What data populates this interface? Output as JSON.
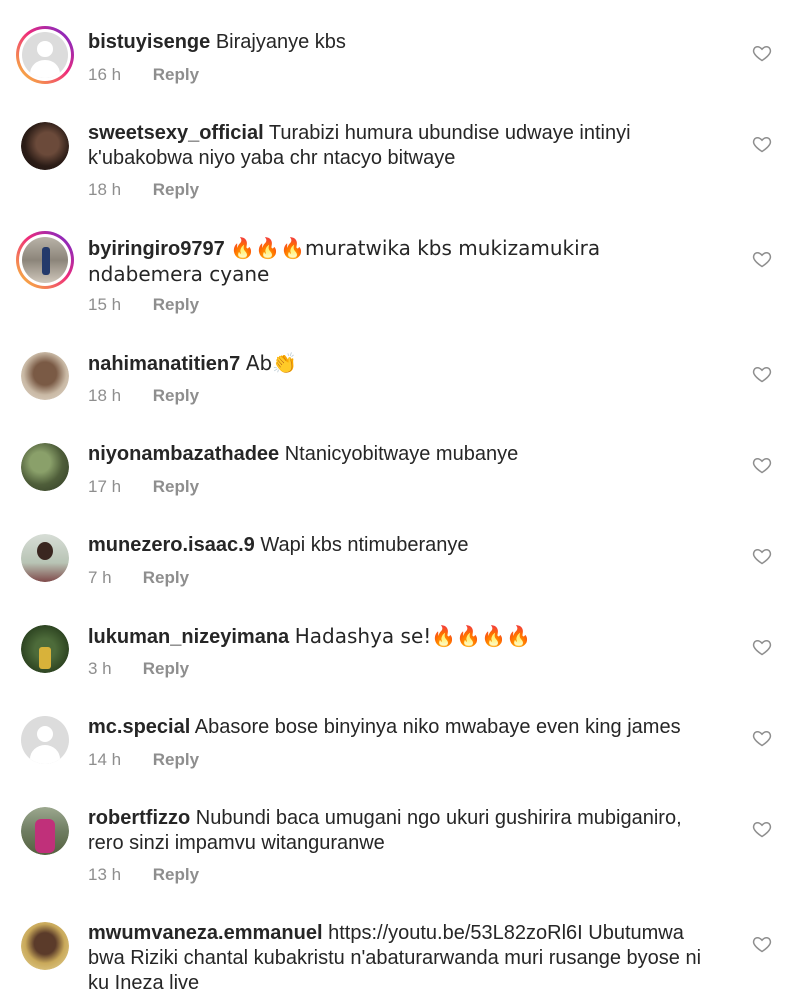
{
  "comments": [
    {
      "username": "bistuyisenge",
      "text": "Birajyanye kbs",
      "time": "16 h",
      "reply": "Reply"
    },
    {
      "username": "sweetsexy_official",
      "text": "Turabizi humura ubundise udwaye intinyi k'ubakobwa niyo yaba chr ntacyo bitwaye",
      "time": "18 h",
      "reply": "Reply"
    },
    {
      "username": "byiringiro9797",
      "text": "🔥🔥🔥muratwika kbs mukizamukira ndabemera cyane",
      "time": "15 h",
      "reply": "Reply"
    },
    {
      "username": "nahimanatitien7",
      "text": "Ab👏",
      "time": "18 h",
      "reply": "Reply"
    },
    {
      "username": "niyonambazathadee",
      "text": "Ntanicyobitwaye mubanye",
      "time": "17 h",
      "reply": "Reply"
    },
    {
      "username": "munezero.isaac.9",
      "text": "Wapi kbs ntimuberanye",
      "time": "7 h",
      "reply": "Reply"
    },
    {
      "username": "lukuman_nizeyimana",
      "text": "Hadashya se!🔥🔥🔥🔥",
      "time": "3 h",
      "reply": "Reply"
    },
    {
      "username": "mc.special",
      "text": "Abasore bose binyinya niko mwabaye even king james",
      "time": "14 h",
      "reply": "Reply"
    },
    {
      "username": "robertfizzo",
      "text": "Nubundi baca umugani ngo ukuri gushirira mubiganiro, rero sinzi impamvu witanguranwe",
      "time": "13 h",
      "reply": "Reply"
    },
    {
      "username": "mwumvaneza.emmanuel",
      "text": "https://youtu.be/53L82zoRl6I Ubutumwa bwa Riziki chantal kubakristu n'abaturarwanda muri rusange byose ni ku Ineza live",
      "time": "",
      "reply": ""
    }
  ],
  "icons": {
    "heart": "heart-outline-icon",
    "default_avatar": "default-avatar-icon"
  },
  "colors": {
    "text": "#262626",
    "meta": "#8e8e8e",
    "ring_start": "#f9ce34",
    "ring_mid": "#ee2a7b",
    "ring_end": "#6228d7"
  }
}
